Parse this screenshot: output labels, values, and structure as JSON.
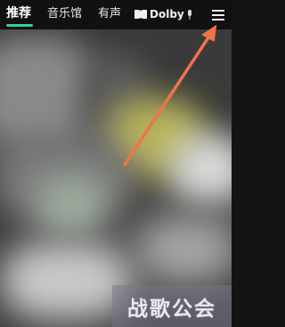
{
  "topnav": {
    "tabs": [
      {
        "label": "推荐",
        "active": true
      },
      {
        "label": "音乐馆",
        "active": false
      },
      {
        "label": "有声",
        "active": false
      }
    ],
    "dolby_label": "Dolby",
    "accent_color": "#33d1a0"
  },
  "icons": {
    "dolby": "dolby-icon",
    "mic": "mic-icon",
    "menu": "menu-icon"
  },
  "annotation": {
    "arrow_color": "#f0734a"
  },
  "watermark": {
    "text": "战歌公会"
  }
}
